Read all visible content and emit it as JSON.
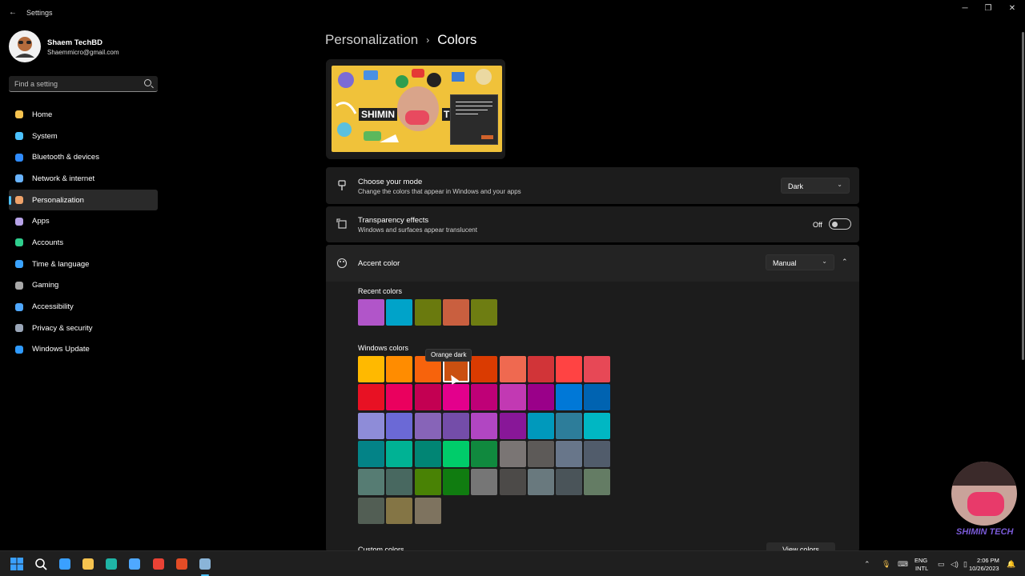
{
  "window": {
    "back_icon": "back-arrow-icon",
    "title": "Settings",
    "controls": [
      "minimize-icon",
      "restore-icon",
      "close-icon"
    ]
  },
  "user": {
    "name": "Shaem TechBD",
    "email": "Shaemmicro@gmail.com"
  },
  "search": {
    "placeholder": "Find a setting"
  },
  "nav": {
    "items": [
      {
        "label": "Home",
        "icon": "home-icon",
        "color": "#f6c34f"
      },
      {
        "label": "System",
        "icon": "monitor-icon",
        "color": "#4cc2ff"
      },
      {
        "label": "Bluetooth & devices",
        "icon": "bluetooth-icon",
        "color": "#2f8cff"
      },
      {
        "label": "Network & internet",
        "icon": "wifi-icon",
        "color": "#69b4ff"
      },
      {
        "label": "Personalization",
        "icon": "brush-icon",
        "color": "#f0a36a"
      },
      {
        "label": "Apps",
        "icon": "apps-icon",
        "color": "#b7a3e8"
      },
      {
        "label": "Accounts",
        "icon": "person-icon",
        "color": "#2fcf8e"
      },
      {
        "label": "Time & language",
        "icon": "globe-clock-icon",
        "color": "#3aa3ff"
      },
      {
        "label": "Gaming",
        "icon": "gamepad-icon",
        "color": "#a8a8a8"
      },
      {
        "label": "Accessibility",
        "icon": "accessibility-icon",
        "color": "#4fa8ff"
      },
      {
        "label": "Privacy & security",
        "icon": "shield-icon",
        "color": "#9aa6b8"
      },
      {
        "label": "Windows Update",
        "icon": "update-icon",
        "color": "#2f9bff"
      }
    ],
    "active_index": 4
  },
  "breadcrumb": {
    "parent": "Personalization",
    "separator": "›",
    "current": "Colors"
  },
  "preview": {
    "brand_left": "SHIMIN",
    "brand_right": "TE"
  },
  "mode": {
    "title": "Choose your mode",
    "subtitle": "Change the colors that appear in Windows and your apps",
    "value": "Dark"
  },
  "transparency": {
    "title": "Transparency effects",
    "subtitle": "Windows and surfaces appear translucent",
    "state_label": "Off"
  },
  "accent": {
    "title": "Accent color",
    "value": "Manual",
    "recent_label": "Recent colors",
    "recent_colors": [
      "#b155c9",
      "#00a3c9",
      "#6a7a0e",
      "#c95f3f",
      "#6e7d12"
    ],
    "windows_label": "Windows colors",
    "windows_colors": [
      [
        "#ffb900",
        "#ff8c00",
        "#f7630c",
        "#ca5010",
        "#da3b01",
        "#ef6950",
        "#d13438",
        "#ff4343",
        "#e74856"
      ],
      [
        "#e81123",
        "#ea005e",
        "#c30052",
        "#e3008c",
        "#bf0077",
        "#c239b3",
        "#9a0089",
        "#0078d7",
        "#0063b1"
      ],
      [
        "#8e8cd8",
        "#6b69d6",
        "#8764b8",
        "#744da9",
        "#b146c2",
        "#881798",
        "#0099bc",
        "#2d7d9a",
        "#00b7c3"
      ],
      [
        "#038387",
        "#00b294",
        "#018574",
        "#00cc6a",
        "#10893e",
        "#7a7574",
        "#5d5a58",
        "#68768a",
        "#515c6b"
      ],
      [
        "#567c73",
        "#486860",
        "#498205",
        "#107c10",
        "#767676",
        "#4c4a48",
        "#69797e",
        "#4a5459",
        "#647c64"
      ],
      [
        "#525e54",
        "#847545",
        "#7e735f"
      ]
    ],
    "selected": {
      "row": 0,
      "col": 3
    },
    "tooltip": "Orange dark",
    "custom_label": "Custom colors",
    "view_colors_label": "View colors"
  },
  "overlay": {
    "webcam_caption": "SHIMIN TECH"
  },
  "taskbar": {
    "apps": [
      {
        "icon": "windows-start-icon",
        "color": "#3aa0ff"
      },
      {
        "icon": "search-icon",
        "color": "#ffffff"
      },
      {
        "icon": "widgets-icon",
        "color": "#3aa0ff"
      },
      {
        "icon": "file-explorer-icon",
        "color": "#f6c34f"
      },
      {
        "icon": "edge-icon",
        "color": "#1fb5a6"
      },
      {
        "icon": "store-icon",
        "color": "#4fa8ff"
      },
      {
        "icon": "chrome-icon",
        "color": "#e94235"
      },
      {
        "icon": "app-icon",
        "color": "#e34c26"
      },
      {
        "icon": "settings-gear-icon",
        "color": "#8ab4d8"
      }
    ],
    "tray_icons": [
      "chevron-up-icon",
      "microphone-icon",
      "keyboard-icon"
    ],
    "lang_top": "ENG",
    "lang_bottom": "INTL",
    "status_icons": [
      "network-icon",
      "volume-icon",
      "battery-icon"
    ],
    "time": "2:06 PM",
    "date": "10/26/2023",
    "notification_icon": "bell-icon"
  }
}
